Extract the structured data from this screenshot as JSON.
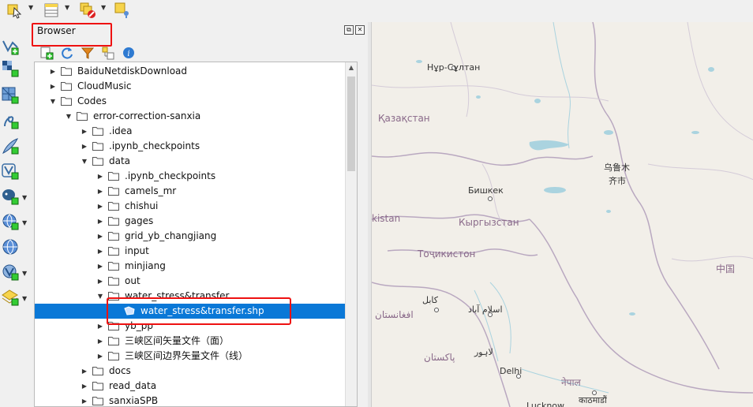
{
  "browser": {
    "title": "Browser",
    "dock_float": "⧉",
    "dock_close": "✕"
  },
  "tree": [
    {
      "label": "BaiduNetdiskDownload",
      "depth": 1,
      "expanded": false
    },
    {
      "label": "CloudMusic",
      "depth": 1,
      "expanded": false
    },
    {
      "label": "Codes",
      "depth": 1,
      "expanded": true
    },
    {
      "label": "error-correction-sanxia",
      "depth": 2,
      "expanded": true
    },
    {
      "label": ".idea",
      "depth": 3,
      "expanded": false
    },
    {
      "label": ".ipynb_checkpoints",
      "depth": 3,
      "expanded": false
    },
    {
      "label": "data",
      "depth": 3,
      "expanded": true
    },
    {
      "label": ".ipynb_checkpoints",
      "depth": 4,
      "expanded": false
    },
    {
      "label": "camels_mr",
      "depth": 4,
      "expanded": false
    },
    {
      "label": "chishui",
      "depth": 4,
      "expanded": false
    },
    {
      "label": "gages",
      "depth": 4,
      "expanded": false
    },
    {
      "label": "grid_yb_changjiang",
      "depth": 4,
      "expanded": false
    },
    {
      "label": "input",
      "depth": 4,
      "expanded": false
    },
    {
      "label": "minjiang",
      "depth": 4,
      "expanded": false
    },
    {
      "label": "out",
      "depth": 4,
      "expanded": false
    },
    {
      "label": "water_stress&transfer",
      "depth": 4,
      "expanded": true
    },
    {
      "label": "water_stress&transfer.shp",
      "depth": 5,
      "expanded": null,
      "selected": true
    },
    {
      "label": "yb_pp",
      "depth": 4,
      "expanded": false
    },
    {
      "label": "三峡区间矢量文件（面）",
      "depth": 4,
      "expanded": false
    },
    {
      "label": "三峡区间边界矢量文件（线）",
      "depth": 4,
      "expanded": false
    },
    {
      "label": "docs",
      "depth": 3,
      "expanded": false
    },
    {
      "label": "read_data",
      "depth": 3,
      "expanded": false
    },
    {
      "label": "sanxiaSPB",
      "depth": 3,
      "expanded": false
    }
  ],
  "map_labels": {
    "nursultan": "Нұр-Сұлтан",
    "kazakhstan": "Қазақстан",
    "urumqi_1": "乌鲁木",
    "urumqi_2": "齐市",
    "bishkek": "Бишкек",
    "kyrgyzstan": "Кыргызстан",
    "uzbekistan_frag": "kistan",
    "tajikistan": "Тоҷикистон",
    "china": "中国",
    "kabul": "کابل",
    "afghanistan": "افغانستان",
    "islamabad": "اسلام آباد",
    "lahore": "لاہور",
    "pakistan": "پاکستان",
    "delhi": "Delhi",
    "nepal": "नेपाल",
    "kathmandu": "काठमाडौं",
    "lucknow": "Lucknow"
  },
  "colors": {
    "selection": "#0a78d7",
    "highlight_box": "#e11111",
    "map_land": "#f2efe9",
    "map_water": "#aad3df"
  }
}
